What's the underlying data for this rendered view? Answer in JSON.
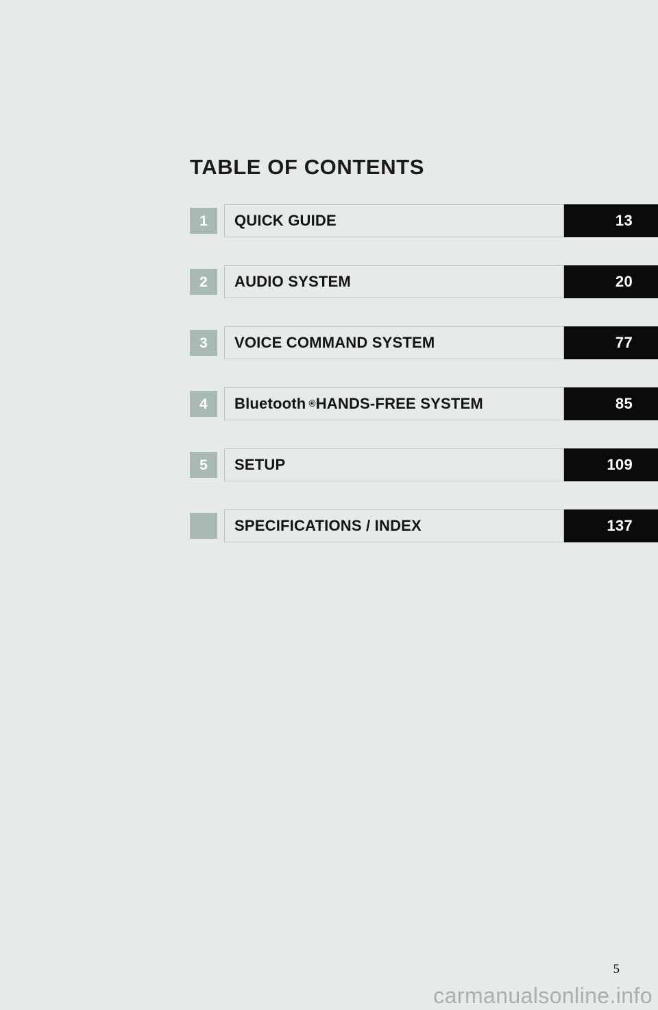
{
  "document": {
    "title": "TABLE OF CONTENTS",
    "page_number": "5",
    "watermark": "carmanualsonline.info"
  },
  "colors": {
    "page_background": "#e6eae9",
    "chapter_chip": "#a9b9b6",
    "page_plate": "#0b0b0b",
    "plate_border": "#b8c4c1",
    "text": "#141414",
    "watermark": "#aab0b0"
  },
  "contents": [
    {
      "number": "1",
      "title": "QUICK GUIDE",
      "title_prefix": "",
      "title_superscript": "",
      "title_suffix": "",
      "page": "13"
    },
    {
      "number": "2",
      "title": "AUDIO SYSTEM",
      "title_prefix": "",
      "title_superscript": "",
      "title_suffix": "",
      "page": "20"
    },
    {
      "number": "3",
      "title": "VOICE COMMAND SYSTEM",
      "title_prefix": "",
      "title_superscript": "",
      "title_suffix": "",
      "page": "77"
    },
    {
      "number": "4",
      "title": "Bluetooth® HANDS-FREE SYSTEM",
      "title_prefix": "Bluetooth",
      "title_superscript": "®",
      "title_suffix": " HANDS-FREE SYSTEM",
      "page": "85"
    },
    {
      "number": "5",
      "title": "SETUP",
      "title_prefix": "",
      "title_superscript": "",
      "title_suffix": "",
      "page": "109"
    },
    {
      "number": "",
      "title": "SPECIFICATIONS / INDEX",
      "title_prefix": "",
      "title_superscript": "",
      "title_suffix": "",
      "page": "137"
    }
  ]
}
